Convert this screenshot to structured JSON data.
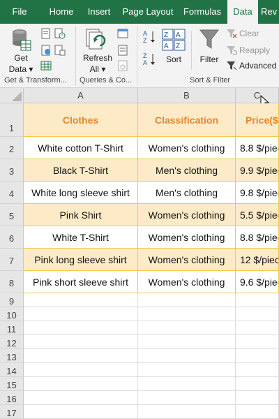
{
  "ribbon_tabs": [
    {
      "label": "File"
    },
    {
      "label": "Home"
    },
    {
      "label": "Insert"
    },
    {
      "label": "Page Layout"
    },
    {
      "label": "Formulas"
    },
    {
      "label": "Data"
    },
    {
      "label": "Rev"
    }
  ],
  "active_tab": "Data",
  "ribbon": {
    "get_data_line1": "Get",
    "get_data_line2": "Data",
    "group_get_transform": "Get & Transform...",
    "refresh_line1": "Refresh",
    "refresh_line2": "All",
    "group_queries": "Queries & Co...",
    "sort_label": "Sort",
    "filter_label": "Filter",
    "clear_label": "Clear",
    "reapply_label": "Reapply",
    "advanced_label": "Advanced",
    "group_sort_filter": "Sort & Filter",
    "az_label": "A Z",
    "za_label": "Z A"
  },
  "grid": {
    "columns": [
      "A",
      "B",
      "C"
    ],
    "row_numbers": [
      "1",
      "2",
      "3",
      "4",
      "5",
      "6",
      "7",
      "8",
      "9",
      "10",
      "11",
      "12",
      "13",
      "14",
      "15",
      "16",
      "17"
    ],
    "header": [
      "Clothes",
      "Classification",
      "Price($"
    ],
    "rows": [
      [
        "White cotton T-Shirt",
        "Women's clothing",
        "8.8 $/piec"
      ],
      [
        "Black T-Shirt",
        "Men's clothing",
        "9.9 $/piec"
      ],
      [
        "White long sleeve shirt",
        "Men's clothing",
        "9.8 $/piec"
      ],
      [
        "Pink Shirt",
        "Women's clothing",
        "5.5 $/piec"
      ],
      [
        "White T-Shirt",
        "Women's clothing",
        "8.8 $/piec"
      ],
      [
        "Pink long sleeve shirt",
        "Women's clothing",
        "12 $/piec"
      ],
      [
        "Pink short sleeve shirt",
        "Women's clothing",
        "9.6 $/piec"
      ]
    ]
  },
  "colors": {
    "ribbon_green": "#217346",
    "header_fill": "#fdebc8",
    "header_text": "#e8842a",
    "cell_border": "#f2c94c"
  }
}
